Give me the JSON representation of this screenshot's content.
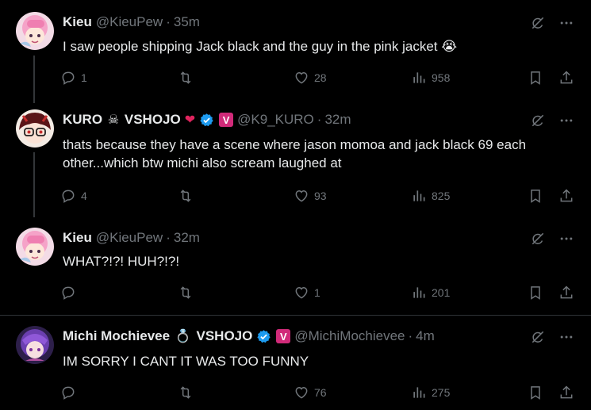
{
  "tweets": [
    {
      "name": "Kieu",
      "handle": "@KieuPew",
      "time": "35m",
      "text": "I saw people shipping Jack black and the guy in the pink jacket 😭",
      "replies": "1",
      "retweets": "",
      "likes": "28",
      "views": "958"
    },
    {
      "name_part1": "KURO",
      "name_emoji": "☠",
      "name_part2": "VSHOJO",
      "name_heart": "❤",
      "vbadge": "V",
      "handle": "@K9_KURO",
      "time": "32m",
      "text": "thats because they have a scene where jason momoa and jack black 69 each other...which btw michi also scream laughed at",
      "replies": "4",
      "retweets": "",
      "likes": "93",
      "views": "825"
    },
    {
      "name": "Kieu",
      "handle": "@KieuPew",
      "time": "32m",
      "text": "WHAT?!?! HUH?!?!",
      "replies": "",
      "retweets": "",
      "likes": "1",
      "views": "201"
    },
    {
      "name_part1": "Michi Mochievee",
      "name_emoji": "💍",
      "name_part2": "VSHOJO",
      "vbadge": "V",
      "handle": "@MichiMochievee",
      "time": "4m",
      "text": "IM SORRY I CANT IT WAS TOO FUNNY",
      "replies": "",
      "retweets": "",
      "likes": "76",
      "views": "275"
    }
  ],
  "separator": "·",
  "more": "···",
  "colors": {
    "text": "#e7e9ea",
    "muted": "#71767b",
    "verified": "#1d9bf0",
    "vshojo": "#d12a79",
    "bg": "#000000"
  }
}
